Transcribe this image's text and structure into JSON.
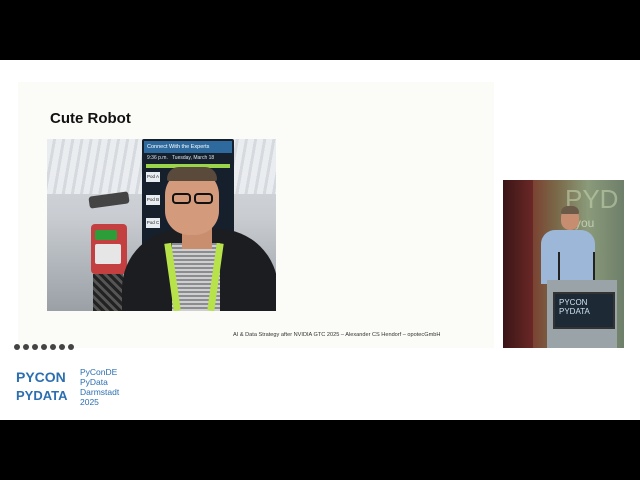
{
  "slide": {
    "title": "Cute Robot",
    "footer": "AI & Data Strategy after NVIDIA GTC 2025 – Alexander CS Hendorf – opotecGmbH"
  },
  "photo_screen": {
    "header": "Connect With the Experts",
    "time": "9:36 p.m.",
    "date": "Tuesday, March 18",
    "pods": [
      "Pod A",
      "Pod B",
      "Pod C"
    ]
  },
  "conference_logo": {
    "mark_line1": "PYCON",
    "mark_line2": "PYDATA",
    "lines": [
      "PyConDE",
      "PyData",
      "Darmstadt",
      "2025"
    ],
    "color": "#2c6fb0"
  },
  "speaker_view": {
    "backdrop_text": "PYD",
    "backdrop_text2": "you",
    "podium_logo_line1": "PYCON",
    "podium_logo_line2": "PYDATA"
  },
  "toolbar_icons": [
    "prev-icon",
    "pen-icon",
    "search-icon",
    "layout-icon",
    "camera-icon",
    "more-icon",
    "next-icon"
  ]
}
